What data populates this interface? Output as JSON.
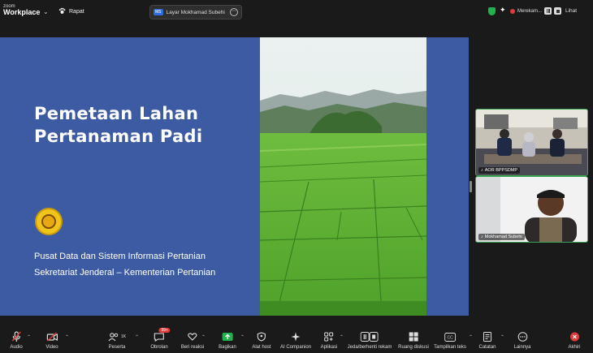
{
  "app": {
    "logo_line1": "zoom",
    "logo_line2": "Workplace",
    "meeting_label": "Rapat"
  },
  "share_pill": {
    "badge": "MS",
    "label": "Layar Mokhamad Subehi"
  },
  "status": {
    "recording_label": "Merekam...",
    "view_label": "Lihat"
  },
  "slide": {
    "title_line1": "Pemetaan Lahan",
    "title_line2": "Pertanaman Padi",
    "org_line1": "Pusat Data dan Sistem Informasi Pertanian",
    "org_line2": "Sekretariat Jenderal – Kementerian Pertanian"
  },
  "participants": [
    {
      "name": "AOR BPPSDMP"
    },
    {
      "name": "Mokhamad Subehi"
    }
  ],
  "toolbar": {
    "audio": "Audio",
    "video": "Video",
    "participants": "Peserta",
    "participants_count": "1K",
    "chat": "Obrolan",
    "chat_badge": "99+",
    "react": "Beri reaksi",
    "share": "Bagikan",
    "host_tools": "Alat host",
    "ai": "AI Companion",
    "apps": "Aplikasi",
    "pause_record": "Jeda/berhenti rekam",
    "breakout": "Ruang diskusi",
    "captions": "Tampilkan teks",
    "notes": "Catatan",
    "more": "Lainnya",
    "end": "Akhiri"
  },
  "colors": {
    "slide_bg": "#3d5ba2",
    "active_speaker": "#3aa654",
    "end_red": "#e03b3b",
    "share_green": "#22b14c"
  }
}
